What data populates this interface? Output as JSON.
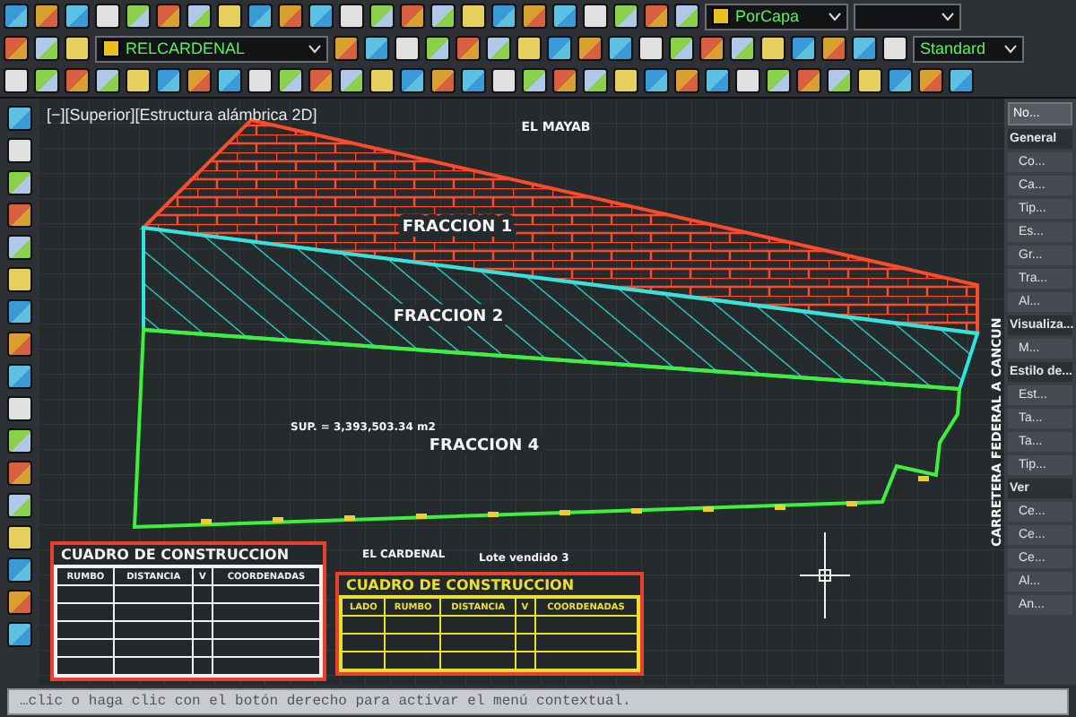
{
  "toolbar": {
    "color_dropdown": {
      "value": "PorCapa"
    },
    "layer_dropdown": {
      "value": "RELCARDENAL"
    },
    "style_dropdown": {
      "value": "Standard"
    }
  },
  "viewport": {
    "label": "[−][Superior][Estructura alámbrica 2D]",
    "north_boundary": "EL MAYAB",
    "parcels": [
      {
        "name": "FRACCION 1",
        "kind": "brick",
        "color": "#ff4a2a"
      },
      {
        "name": "FRACCION 2",
        "kind": "diagonal",
        "color": "#2ee6e0"
      },
      {
        "name": "FRACCION 4",
        "kind": "plain",
        "color": "#3cf03c"
      }
    ],
    "area_note": "SUP. = 3,393,503.34 m2",
    "road_label": "CARRETERA FEDERAL A CANCUN",
    "south_boundary": "EL CARDENAL",
    "lot_label": "Lote vendido 3",
    "tables": [
      {
        "title": "CUADRO DE CONSTRUCCION",
        "color": "#f0f0f0",
        "columns": [
          "RUMBO",
          "DISTANCIA",
          "V",
          "COORDENADAS"
        ]
      },
      {
        "title": "CUADRO DE CONSTRUCCION",
        "color": "#e8e030",
        "columns": [
          "LADO",
          "RUMBO",
          "DISTANCIA",
          "V",
          "COORDENADAS"
        ]
      }
    ]
  },
  "properties": {
    "selector": "No...",
    "items": [
      {
        "kind": "section",
        "text": "General"
      },
      {
        "kind": "property",
        "text": "Co..."
      },
      {
        "kind": "property",
        "text": "Ca..."
      },
      {
        "kind": "property",
        "text": "Tip..."
      },
      {
        "kind": "property",
        "text": "Es..."
      },
      {
        "kind": "property",
        "text": "Gr..."
      },
      {
        "kind": "property",
        "text": "Tra..."
      },
      {
        "kind": "property",
        "text": "Al..."
      },
      {
        "kind": "section",
        "text": "Visualiza..."
      },
      {
        "kind": "property",
        "text": "M..."
      },
      {
        "kind": "section",
        "text": "Estilo de..."
      },
      {
        "kind": "property",
        "text": "Est..."
      },
      {
        "kind": "property",
        "text": "Ta..."
      },
      {
        "kind": "property",
        "text": "Ta..."
      },
      {
        "kind": "property",
        "text": "Tip..."
      },
      {
        "kind": "section",
        "text": "Ver"
      },
      {
        "kind": "property",
        "text": "Ce..."
      },
      {
        "kind": "property",
        "text": "Ce..."
      },
      {
        "kind": "property",
        "text": "Ce..."
      },
      {
        "kind": "property",
        "text": "Al..."
      },
      {
        "kind": "property",
        "text": "An..."
      }
    ]
  },
  "command_line": "…clic o haga clic con el botón derecho para activar el menú contextual."
}
